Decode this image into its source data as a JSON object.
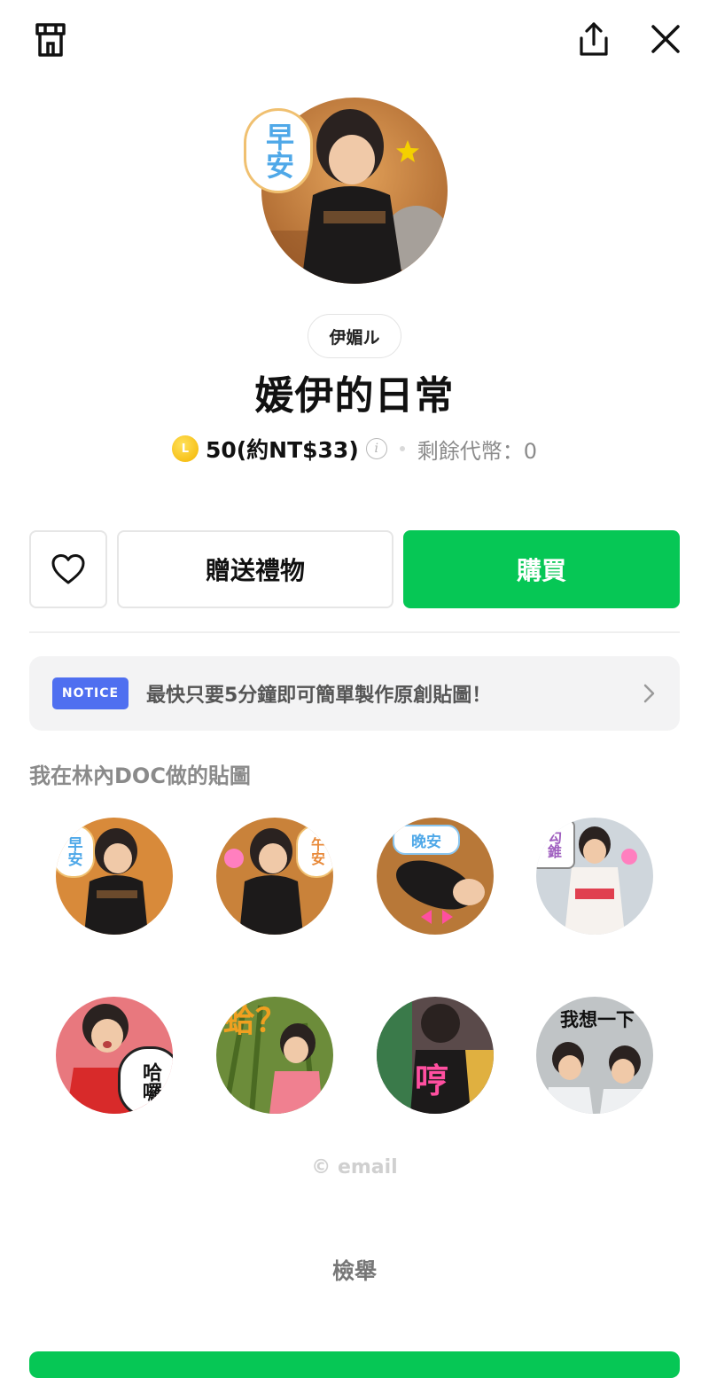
{
  "topbar": {
    "shop_icon": "shop-icon",
    "share_icon": "share-icon",
    "close_icon": "close-icon"
  },
  "sticker_pack": {
    "author": "伊媚ル",
    "title": "媛伊的日常",
    "price": "50(約NT$33)",
    "coin_letter": "L",
    "info_glyph": "i",
    "balance": "剩餘代幣：0"
  },
  "actions": {
    "favorite_icon": "heart-icon",
    "gift_label": "贈送禮物",
    "buy_label": "購買"
  },
  "notice": {
    "badge": "NOTICE",
    "text": "最快只要5分鐘即可簡單製作原創貼圖！"
  },
  "section_label": "我在林內DOC做的貼圖",
  "stickers": [
    {
      "caption": "早安",
      "bg": "#d88a3a"
    },
    {
      "caption": "午安",
      "bg": "#c9823a"
    },
    {
      "caption": "晚安",
      "bg": "#b87838"
    },
    {
      "caption": "勾錐",
      "bg": "#cfd6dc"
    },
    {
      "caption": "哈囉",
      "bg": "#e8787e"
    },
    {
      "caption": "蛤？",
      "bg": "#6c8c3a"
    },
    {
      "caption": "哼",
      "bg": "#5a4a4a"
    },
    {
      "caption": "我想一下",
      "bg": "#c0c4c6"
    }
  ],
  "hero_caption": "早安",
  "copyright": "© email",
  "report": "檢舉",
  "colors": {
    "accent_green": "#06c755",
    "notice_badge": "#4f6ff0"
  }
}
